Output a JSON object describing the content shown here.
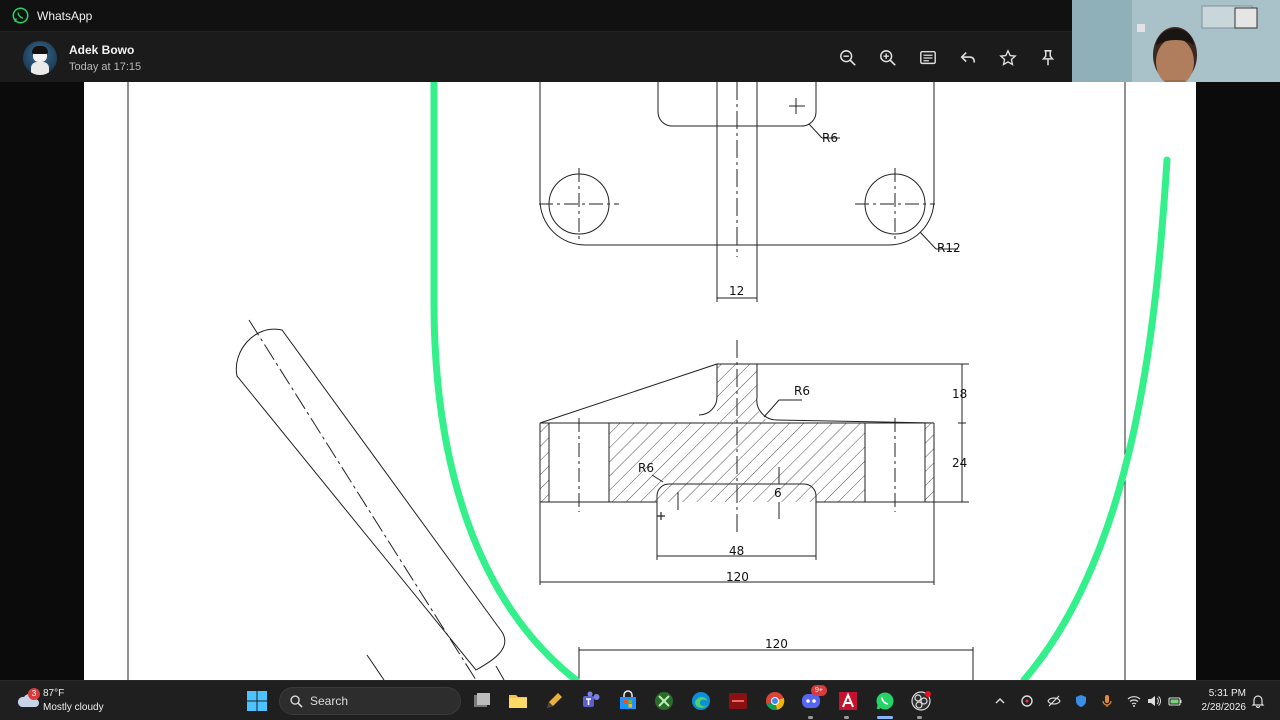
{
  "window": {
    "app_title": "WhatsApp"
  },
  "viewer_header": {
    "sender_name": "Adek Bowo",
    "timestamp": "Today at 17:15",
    "actions": [
      "zoom-out-icon",
      "zoom-in-icon",
      "caption-icon",
      "reply-icon",
      "star-icon",
      "pin-icon"
    ]
  },
  "drawing": {
    "labels": {
      "r6_top": "R6",
      "r12": "R12",
      "dim_12": "12",
      "r6_mid": "R6",
      "dim_18": "18",
      "dim_24": "24",
      "r6_low": "R6",
      "dim_6": "6",
      "dim_48": "48",
      "dim_120_a": "120",
      "dim_120_b": "120"
    },
    "annotation_color": "#33f08a"
  },
  "taskbar": {
    "weather": {
      "badge": "3",
      "temperature": "87°F",
      "condition": "Mostly cloudy"
    },
    "search_placeholder": "Search",
    "apps": [
      "task-view",
      "file-explorer",
      "pen-app",
      "teams",
      "store",
      "xbox",
      "edge",
      "red-app",
      "chrome",
      "discord",
      "autocad",
      "whatsapp",
      "obs"
    ],
    "discord_badge": "9+",
    "clock": {
      "time": "5:31 PM",
      "date": "2/28/2026"
    }
  }
}
